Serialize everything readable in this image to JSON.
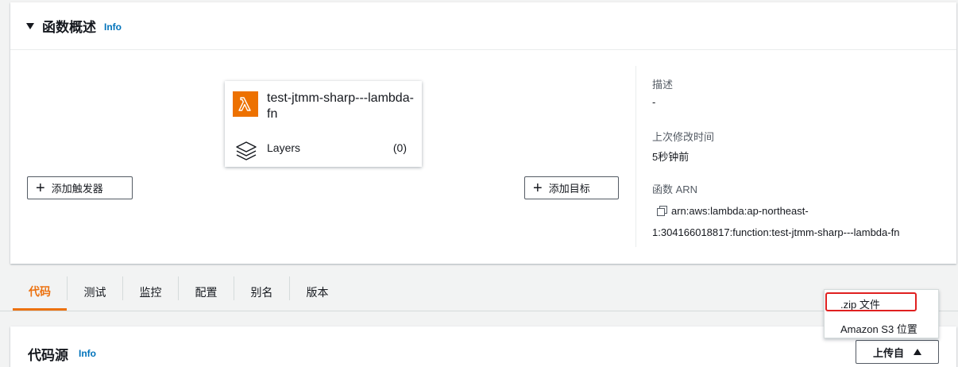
{
  "overview": {
    "title": "函数概述",
    "info": "Info",
    "function_name": "test-jtmm-sharp---lambda-fn",
    "layers_label": "Layers",
    "layers_count": "(0)",
    "add_trigger": "添加触发器",
    "add_destination": "添加目标",
    "description_label": "描述",
    "description_value": "-",
    "last_modified_label": "上次修改时间",
    "last_modified_value": "5秒钟前",
    "arn_label": "函数 ARN",
    "arn_line1": "arn:aws:lambda:ap-northeast-",
    "arn_line2": "1:304166018817:function:test-jtmm-sharp---lambda-fn"
  },
  "tabs": [
    {
      "label": "代码",
      "active": true
    },
    {
      "label": "测试"
    },
    {
      "label": "监控"
    },
    {
      "label": "配置"
    },
    {
      "label": "别名"
    },
    {
      "label": "版本"
    }
  ],
  "code_source": {
    "title": "代码源",
    "info": "Info",
    "upload_label": "上传自"
  },
  "upload_menu": {
    "items": [
      ".zip 文件",
      "Amazon S3 位置"
    ],
    "highlighted": ".zip 文件"
  },
  "colors": {
    "accent": "#ec7211",
    "link": "#0073bb",
    "lambda_icon": "#ed7100",
    "highlight_box": "#e02020"
  }
}
